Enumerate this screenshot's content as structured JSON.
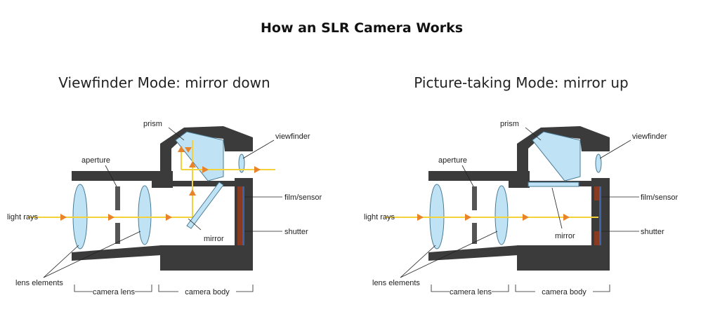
{
  "title": "How an SLR Camera Works",
  "panels": [
    {
      "heading": "Viewfinder Mode: mirror down",
      "labels": {
        "prism": "prism",
        "viewfinder": "viewfinder",
        "aperture": "aperture",
        "film": "film/sensor",
        "light": "light rays",
        "shutter": "shutter",
        "mirror": "mirror",
        "lens_elements": "lens elements",
        "camera_lens": "camera lens",
        "camera_body": "camera body"
      }
    },
    {
      "heading": "Picture-taking Mode: mirror up",
      "labels": {
        "prism": "prism",
        "viewfinder": "viewfinder",
        "aperture": "aperture",
        "film": "film/sensor",
        "light": "light rays",
        "shutter": "shutter",
        "mirror": "mirror",
        "lens_elements": "lens elements",
        "camera_lens": "camera lens",
        "camera_body": "camera body"
      }
    }
  ],
  "colors": {
    "body": "#3b3b3b",
    "glass": "#bfe3f4",
    "glass_stroke": "#4a7a95",
    "light_ray": "#f4d23a",
    "arrow": "#e8832a",
    "film": "#8b3a22",
    "sensor": "#3b63a8"
  }
}
